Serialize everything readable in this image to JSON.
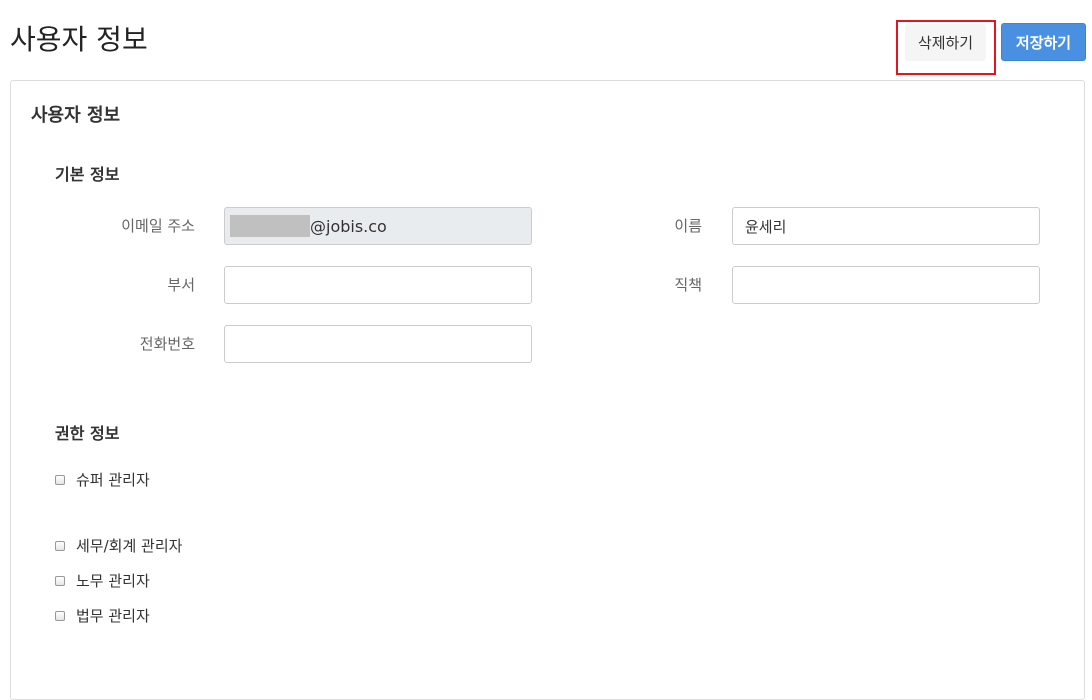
{
  "header": {
    "title": "사용자 정보",
    "delete_label": "삭제하기",
    "save_label": "저장하기"
  },
  "panel": {
    "title": "사용자 정보"
  },
  "basic_info": {
    "section_title": "기본 정보",
    "email_label": "이메일 주소",
    "email_value": "@jobis.co",
    "name_label": "이름",
    "name_value": "윤세리",
    "department_label": "부서",
    "department_value": "",
    "position_label": "직책",
    "position_value": "",
    "phone_label": "전화번호",
    "phone_value": ""
  },
  "permissions": {
    "section_title": "권한 정보",
    "items": [
      {
        "label": "슈퍼 관리자",
        "checked": false
      },
      {
        "label": "세무/회계 관리자",
        "checked": false
      },
      {
        "label": "노무 관리자",
        "checked": false
      },
      {
        "label": "법무 관리자",
        "checked": false
      }
    ]
  },
  "colors": {
    "primary": "#4a90e2",
    "highlight": "#e3161f",
    "readonly_bg": "#e9ecef"
  }
}
